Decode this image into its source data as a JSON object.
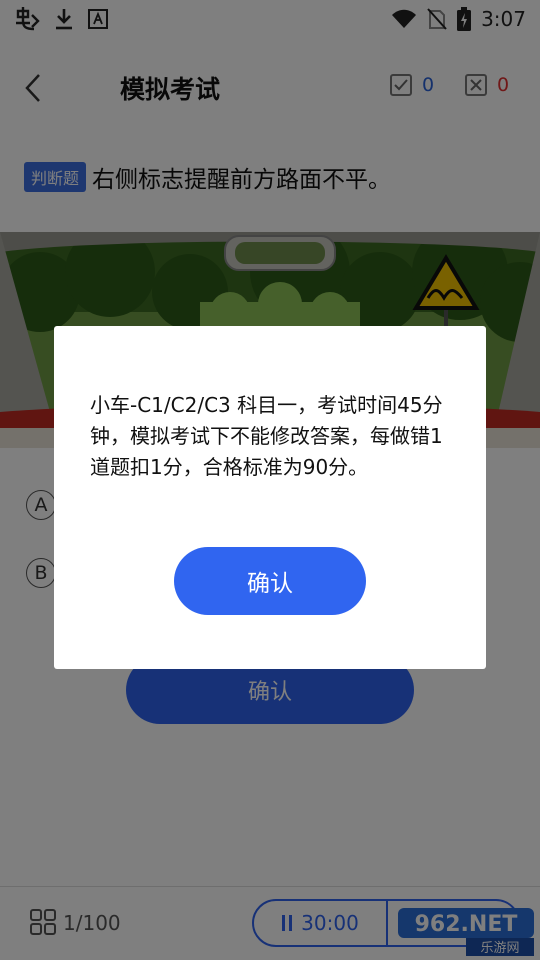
{
  "status_bar": {
    "time": "3:07",
    "left_icons": [
      "bug-app-icon",
      "download-icon",
      "text-a-icon"
    ],
    "right_icons": [
      "wifi-icon",
      "no-sim-icon",
      "battery-charging-icon"
    ]
  },
  "header": {
    "title": "模拟考试",
    "correct_count": "0",
    "wrong_count": "0",
    "colors": {
      "correct": "#2a62d8",
      "wrong": "#e03030"
    }
  },
  "question": {
    "type_tag": "判断题",
    "text": "右侧标志提醒前方路面不平。"
  },
  "options": [
    {
      "letter": "A"
    },
    {
      "letter": "B"
    }
  ],
  "submit_label": "确认",
  "bottom_bar": {
    "progress": "1/100",
    "timer": "30:00"
  },
  "watermark": {
    "brand": "962.NET",
    "sub": "乐游网"
  },
  "dialog": {
    "message": "小车-C1/C2/C3 科目一，考试时间45分钟，模拟考试下不能修改答案，每做错1道题扣1分，合格标准为90分。",
    "confirm_label": "确认"
  },
  "colors": {
    "accent": "#2f63ee",
    "tag": "#3d6fe0"
  }
}
